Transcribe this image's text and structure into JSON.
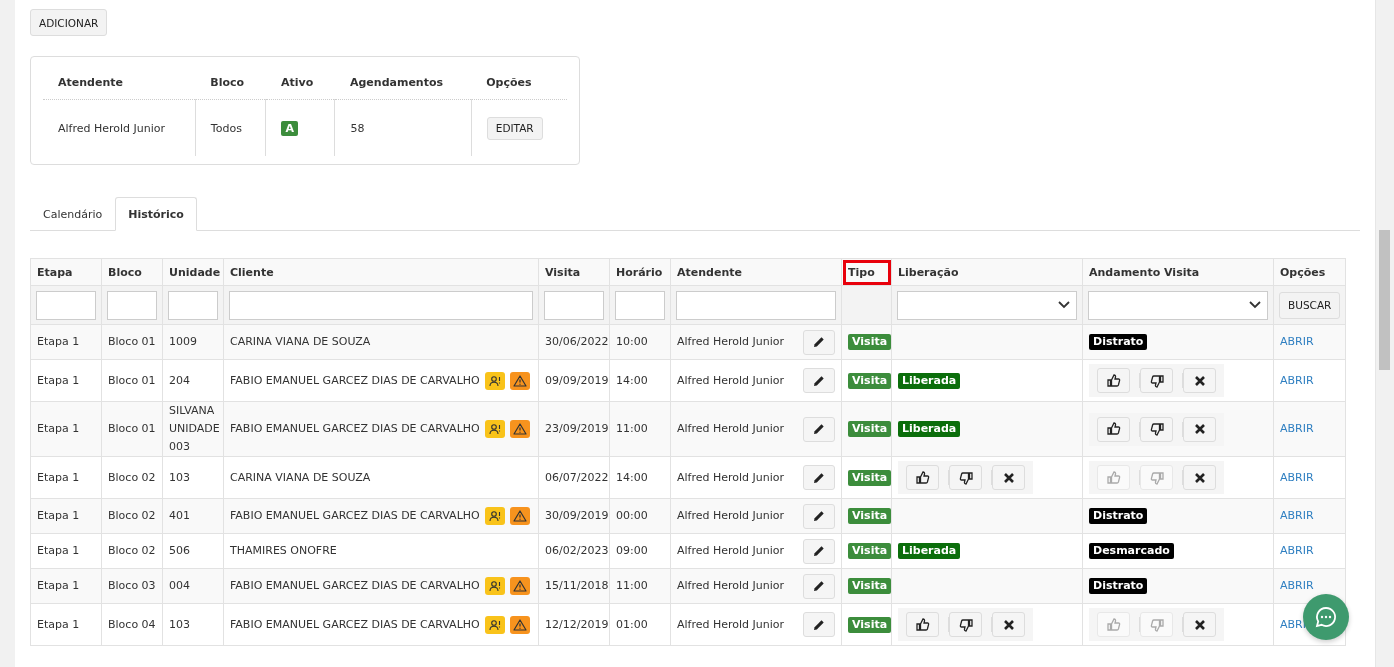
{
  "add_button": "ADICIONAR",
  "attendant_table": {
    "columns": [
      "Atendente",
      "Bloco",
      "Ativo",
      "Agendamentos",
      "Opções"
    ],
    "rows": [
      {
        "atendente": "Alfred Herold Junior",
        "bloco": "Todos",
        "ativo": "A",
        "agendamentos": "58",
        "option": "EDITAR"
      }
    ]
  },
  "tabs": [
    {
      "label": "Calendário",
      "selected": false
    },
    {
      "label": "Histórico",
      "selected": true
    }
  ],
  "table": {
    "columns": [
      {
        "label": "Etapa",
        "kind": "text",
        "highlighted": false
      },
      {
        "label": "Bloco",
        "kind": "text",
        "highlighted": false
      },
      {
        "label": "Unidade",
        "kind": "text",
        "highlighted": false
      },
      {
        "label": "Cliente",
        "kind": "text",
        "highlighted": false
      },
      {
        "label": "Visita",
        "kind": "text",
        "highlighted": false
      },
      {
        "label": "Horário",
        "kind": "text",
        "highlighted": false
      },
      {
        "label": "Atendente",
        "kind": "text",
        "highlighted": false
      },
      {
        "label": "Tipo",
        "kind": "none",
        "highlighted": true
      },
      {
        "label": "Liberação",
        "kind": "select",
        "highlighted": false
      },
      {
        "label": "Andamento Visita",
        "kind": "select",
        "highlighted": false
      },
      {
        "label": "Opções",
        "kind": "button",
        "highlighted": false
      }
    ],
    "search_button": "BUSCAR",
    "rows": [
      {
        "etapa": "Etapa 1",
        "bloco": "Bloco 01",
        "unidade": "1009",
        "cliente": "CARINA VIANA DE SOUZA",
        "alerts": false,
        "visita": "30/06/2022",
        "horario": "10:00",
        "atendente": "Alfred Herold Junior",
        "tipo": "Visita",
        "liberacao": {
          "kind": "none"
        },
        "andamento": {
          "kind": "badge",
          "label": "Distrato"
        },
        "option": "ABRIR"
      },
      {
        "etapa": "Etapa 1",
        "bloco": "Bloco 01",
        "unidade": "204",
        "cliente": "FABIO EMANUEL GARCEZ DIAS DE CARVALHO",
        "alerts": true,
        "visita": "09/09/2019",
        "horario": "14:00",
        "atendente": "Alfred Herold Junior",
        "tipo": "Visita",
        "liberacao": {
          "kind": "badge",
          "label": "Liberada"
        },
        "andamento": {
          "kind": "actions",
          "disabled": false
        },
        "option": "ABRIR"
      },
      {
        "etapa": "Etapa 1",
        "bloco": "Bloco 01",
        "unidade": "SILVANA UNIDADE 003",
        "cliente": "FABIO EMANUEL GARCEZ DIAS DE CARVALHO",
        "alerts": true,
        "visita": "23/09/2019",
        "horario": "11:00",
        "atendente": "Alfred Herold Junior",
        "tipo": "Visita",
        "liberacao": {
          "kind": "badge",
          "label": "Liberada"
        },
        "andamento": {
          "kind": "actions",
          "disabled": false
        },
        "option": "ABRIR"
      },
      {
        "etapa": "Etapa 1",
        "bloco": "Bloco 02",
        "unidade": "103",
        "cliente": "CARINA VIANA DE SOUZA",
        "alerts": false,
        "visita": "06/07/2022",
        "horario": "14:00",
        "atendente": "Alfred Herold Junior",
        "tipo": "Visita",
        "liberacao": {
          "kind": "actions",
          "disabled": false
        },
        "andamento": {
          "kind": "actions",
          "disabled": true
        },
        "option": "ABRIR"
      },
      {
        "etapa": "Etapa 1",
        "bloco": "Bloco 02",
        "unidade": "401",
        "cliente": "FABIO EMANUEL GARCEZ DIAS DE CARVALHO",
        "alerts": true,
        "visita": "30/09/2019",
        "horario": "00:00",
        "atendente": "Alfred Herold Junior",
        "tipo": "Visita",
        "liberacao": {
          "kind": "none"
        },
        "andamento": {
          "kind": "badge",
          "label": "Distrato"
        },
        "option": "ABRIR"
      },
      {
        "etapa": "Etapa 1",
        "bloco": "Bloco 02",
        "unidade": "506",
        "cliente": "THAMIRES ONOFRE",
        "alerts": false,
        "visita": "06/02/2023",
        "horario": "09:00",
        "atendente": "Alfred Herold Junior",
        "tipo": "Visita",
        "liberacao": {
          "kind": "badge",
          "label": "Liberada"
        },
        "andamento": {
          "kind": "badge",
          "label": "Desmarcado"
        },
        "option": "ABRIR"
      },
      {
        "etapa": "Etapa 1",
        "bloco": "Bloco 03",
        "unidade": "004",
        "cliente": "FABIO EMANUEL GARCEZ DIAS DE CARVALHO",
        "alerts": true,
        "visita": "15/11/2018",
        "horario": "11:00",
        "atendente": "Alfred Herold Junior",
        "tipo": "Visita",
        "liberacao": {
          "kind": "none"
        },
        "andamento": {
          "kind": "badge",
          "label": "Distrato"
        },
        "option": "ABRIR"
      },
      {
        "etapa": "Etapa 1",
        "bloco": "Bloco 04",
        "unidade": "103",
        "cliente": "FABIO EMANUEL GARCEZ DIAS DE CARVALHO",
        "alerts": true,
        "visita": "12/12/2019",
        "horario": "01:00",
        "atendente": "Alfred Herold Junior",
        "tipo": "Visita",
        "liberacao": {
          "kind": "actions",
          "disabled": false
        },
        "andamento": {
          "kind": "actions",
          "disabled": true
        },
        "option": "ABRI"
      }
    ]
  }
}
